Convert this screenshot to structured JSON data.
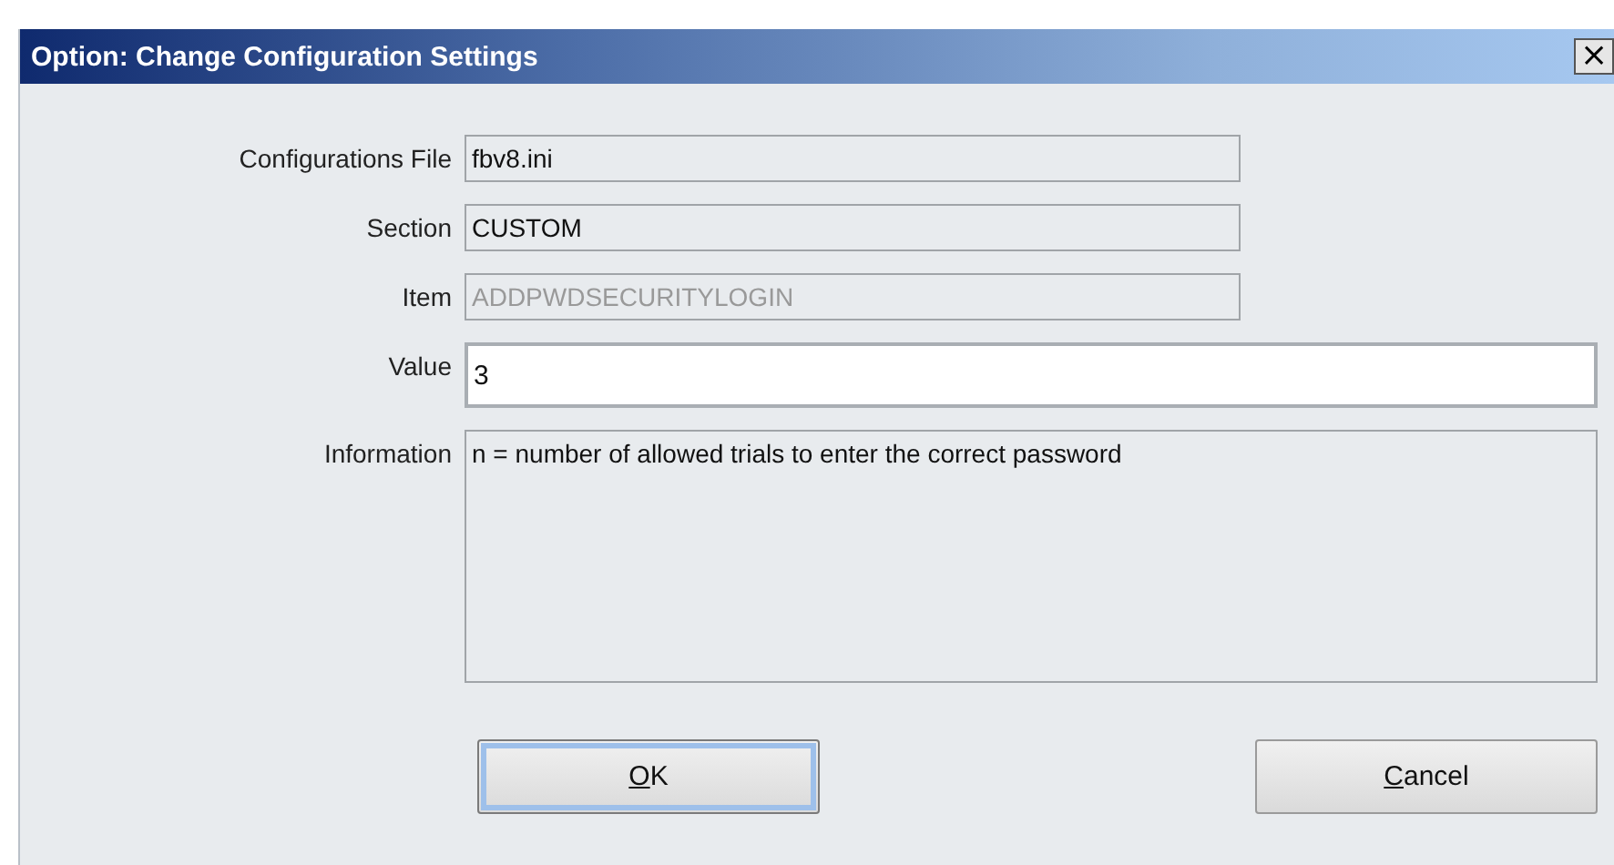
{
  "window": {
    "title": "Option: Change Configuration Settings",
    "close": "×"
  },
  "fields": [
    {
      "label": "Configurations File",
      "value": "fbv8.ini",
      "kind": "readonly",
      "disabled": false
    },
    {
      "label": "Section",
      "value": "CUSTOM",
      "kind": "readonly",
      "disabled": false
    },
    {
      "label": "Item",
      "value": "ADDPWDSECURITYLOGIN",
      "kind": "readonly",
      "disabled": true
    },
    {
      "label": "Value",
      "value": "3",
      "kind": "input",
      "disabled": false
    },
    {
      "label": "Information",
      "value": "n = number of allowed trials to enter the correct password",
      "kind": "memo",
      "disabled": false
    }
  ],
  "buttons": [
    {
      "access_key": "O",
      "rest": "K",
      "default": true
    },
    {
      "access_key": "C",
      "rest": "ancel",
      "default": false
    }
  ]
}
